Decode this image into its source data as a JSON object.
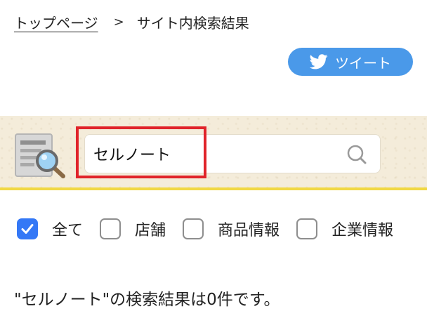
{
  "breadcrumb": {
    "home_label": "トップページ",
    "separator": ">",
    "current_label": "サイト内検索結果"
  },
  "tweet_button": {
    "label": "ツイート",
    "icon": "twitter-bird-icon",
    "color": "#4a99e9"
  },
  "search": {
    "value": "セルノート",
    "page_icon": "search-document-icon",
    "submit_icon": "search-icon",
    "band_color": "#f4ecda",
    "underline_color": "#f1d843",
    "highlight_color": "#e0232a"
  },
  "filters": [
    {
      "label": "全て",
      "checked": true
    },
    {
      "label": "店舗",
      "checked": false
    },
    {
      "label": "商品情報",
      "checked": false
    },
    {
      "label": "企業情報",
      "checked": false
    }
  ],
  "result": {
    "message": "\"セルノート\"の検索結果は0件です。"
  },
  "colors": {
    "checkbox_checked": "#3478f6"
  }
}
